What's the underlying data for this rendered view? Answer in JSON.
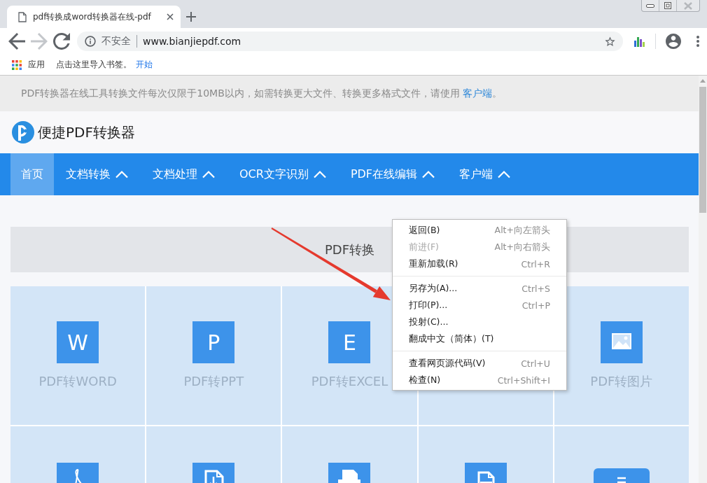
{
  "browser": {
    "tab": {
      "title": "pdf转换成word转换器在线-pdf",
      "selected": true
    },
    "nav_buttons": [
      {
        "kind": "back",
        "disabled": false
      },
      {
        "kind": "forward",
        "disabled": true
      },
      {
        "kind": "reload",
        "disabled": false
      }
    ],
    "address_bar": {
      "security_label": "不安全",
      "url": "www.bianjiepdf.com"
    },
    "bookmarks_bar": {
      "apps_label": "应用",
      "hint": "点击这里导入书签。",
      "link": "开始"
    }
  },
  "page": {
    "notice": {
      "text": "PDF转换器在线工具转换文件每次仅限于10MB以内，如需转换更大文件、转换更多格式文件，请使用",
      "link": "客户端",
      "end": "。"
    },
    "logo_text": "便捷PDF转换器",
    "nav": [
      {
        "label": "首页",
        "selected": true,
        "has_menu": false
      },
      {
        "label": "文档转换",
        "selected": false,
        "has_menu": true
      },
      {
        "label": "文档处理",
        "selected": false,
        "has_menu": true
      },
      {
        "label": "OCR文字识别",
        "selected": false,
        "has_menu": true
      },
      {
        "label": "PDF在线编辑",
        "selected": false,
        "has_menu": true
      },
      {
        "label": "客户端",
        "selected": false,
        "has_menu": true
      }
    ],
    "section_title": "PDF转换",
    "tiles": [
      {
        "kind": "letter",
        "letter": "W",
        "label": "PDF转WORD"
      },
      {
        "kind": "letter",
        "letter": "P",
        "label": "PDF转PPT"
      },
      {
        "kind": "letter",
        "letter": "E",
        "label": "PDF转EXCEL"
      },
      {
        "kind": "blank"
      },
      {
        "kind": "image",
        "label": "PDF转图片"
      },
      {
        "kind": "pdf-symbol"
      },
      {
        "kind": "document"
      },
      {
        "kind": "printer"
      },
      {
        "kind": "pdf-file"
      },
      {
        "kind": "list"
      }
    ]
  },
  "context_menu": {
    "groups": [
      {
        "items": [
          {
            "label": "返回(B)",
            "shortcut": "Alt+向左箭头",
            "disabled": false
          },
          {
            "label": "前进(F)",
            "shortcut": "Alt+向右箭头",
            "disabled": true
          },
          {
            "label": "重新加载(R)",
            "shortcut": "Ctrl+R",
            "disabled": false
          }
        ]
      },
      {
        "items": [
          {
            "label": "另存为(A)...",
            "shortcut": "Ctrl+S",
            "disabled": false
          },
          {
            "label": "打印(P)...",
            "shortcut": "Ctrl+P",
            "disabled": false
          },
          {
            "label": "投射(C)...",
            "disabled": false
          },
          {
            "label": "翻成中文（简体）(T)",
            "disabled": false
          }
        ]
      },
      {
        "items": [
          {
            "label": "查看网页源代码(V)",
            "shortcut": "Ctrl+U",
            "disabled": false
          },
          {
            "label": "检查(N)",
            "shortcut": "Ctrl+Shift+I",
            "disabled": false
          }
        ]
      }
    ]
  }
}
